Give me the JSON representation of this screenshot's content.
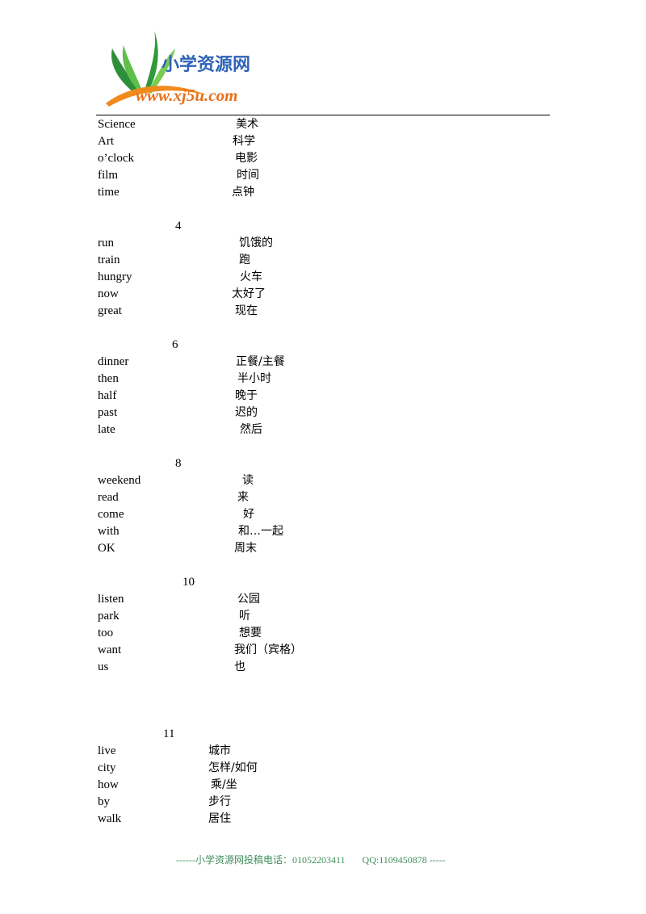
{
  "header": {
    "logo_name": "小学资源网",
    "logo_url": "www.xj5u.com",
    "colors": {
      "logo_blue": "#2f63b8",
      "logo_orange": "#e8701a",
      "leaf_green": "#2e9a3a",
      "footer_green": "#3f8f5a"
    }
  },
  "groups": [
    {
      "number": "",
      "english": [
        "Science",
        "Art",
        "o’clock",
        "film",
        "time"
      ],
      "chinese": [
        "美术",
        "科学",
        "电影",
        "时间",
        "点钟"
      ]
    },
    {
      "number": "4",
      "english": [
        "run",
        "train",
        "hungry",
        "now",
        "great"
      ],
      "chinese": [
        "饥饿的",
        "跑",
        "火车",
        "太好了",
        "现在"
      ]
    },
    {
      "number": "6",
      "english": [
        "dinner",
        "then",
        "half",
        "past",
        "late"
      ],
      "chinese": [
        "正餐/主餐",
        "半小时",
        "晚于",
        "迟的",
        "然后"
      ]
    },
    {
      "number": "8",
      "english": [
        "weekend",
        "read",
        "come",
        "with",
        "OK"
      ],
      "chinese": [
        "读",
        "来",
        "好",
        "和…一起",
        "周末"
      ]
    },
    {
      "number": "10",
      "english": [
        "listen",
        "park",
        "too",
        "want",
        "us"
      ],
      "chinese": [
        "公园",
        "听",
        "想要",
        "我们（宾格）",
        "也"
      ]
    },
    {
      "number": "11",
      "english": [
        "live",
        "city",
        "how",
        "by",
        "walk"
      ],
      "chinese": [
        "城市",
        "怎样/如何",
        "乘/坐",
        "步行",
        "居住"
      ]
    }
  ],
  "footer": {
    "text": "------小学资源网投稿电话：01052203411       QQ:1109450878 -----"
  }
}
